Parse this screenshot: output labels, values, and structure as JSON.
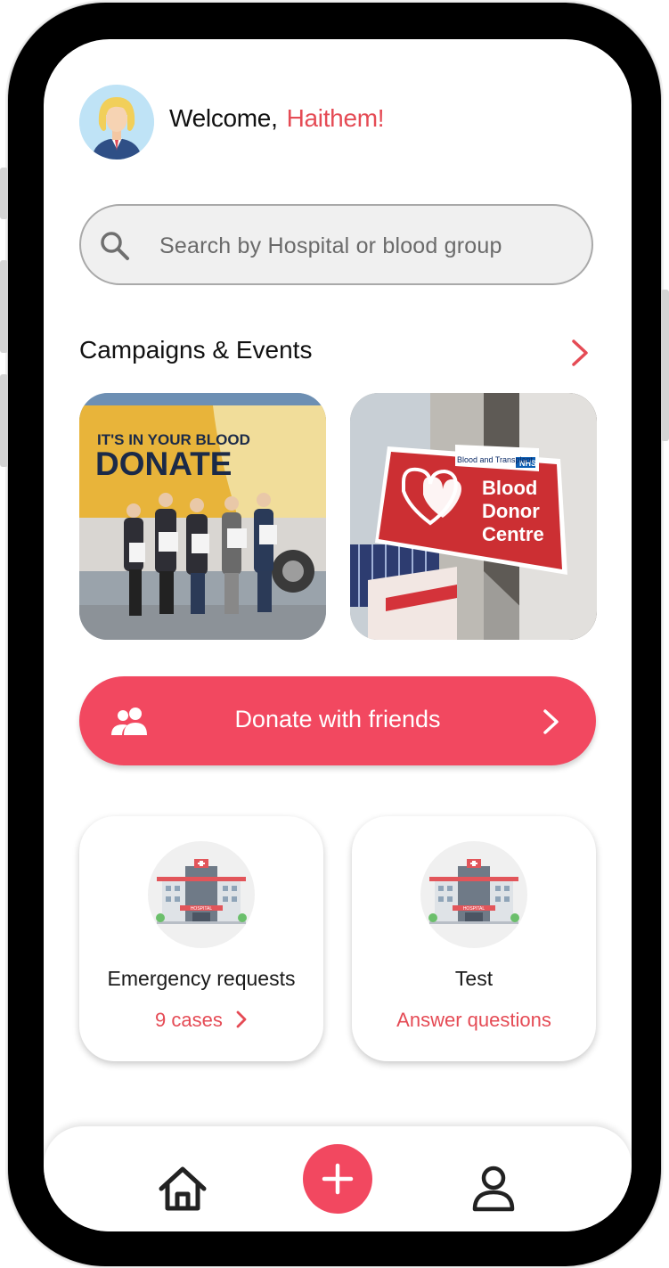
{
  "header": {
    "greeting": "Welcome,",
    "user_name": "Haithem!"
  },
  "search": {
    "placeholder": "Search by Hospital or blood group"
  },
  "campaigns": {
    "title": "Campaigns & Events",
    "images": [
      {
        "banner_line1": "IT'S IN YOUR BLOOD",
        "banner_line2": "DONATE"
      },
      {
        "sign_brand": "NHS",
        "sign_org": "Blood and Transplant",
        "sign_line1": "Blood",
        "sign_line2": "Donor",
        "sign_line3": "Centre"
      }
    ]
  },
  "donate_friends": {
    "label": "Donate with friends"
  },
  "tiles": [
    {
      "title": "Emergency requests",
      "subtitle": "9 cases"
    },
    {
      "title": "Test",
      "subtitle": "Answer questions"
    }
  ],
  "hospital_sign": "HOSPITAL",
  "colors": {
    "accent": "#f24860",
    "accent_text": "#e54b55"
  },
  "icons": [
    "search-icon",
    "chevron-right-icon",
    "people-icon",
    "home-icon",
    "plus-icon",
    "user-icon"
  ]
}
